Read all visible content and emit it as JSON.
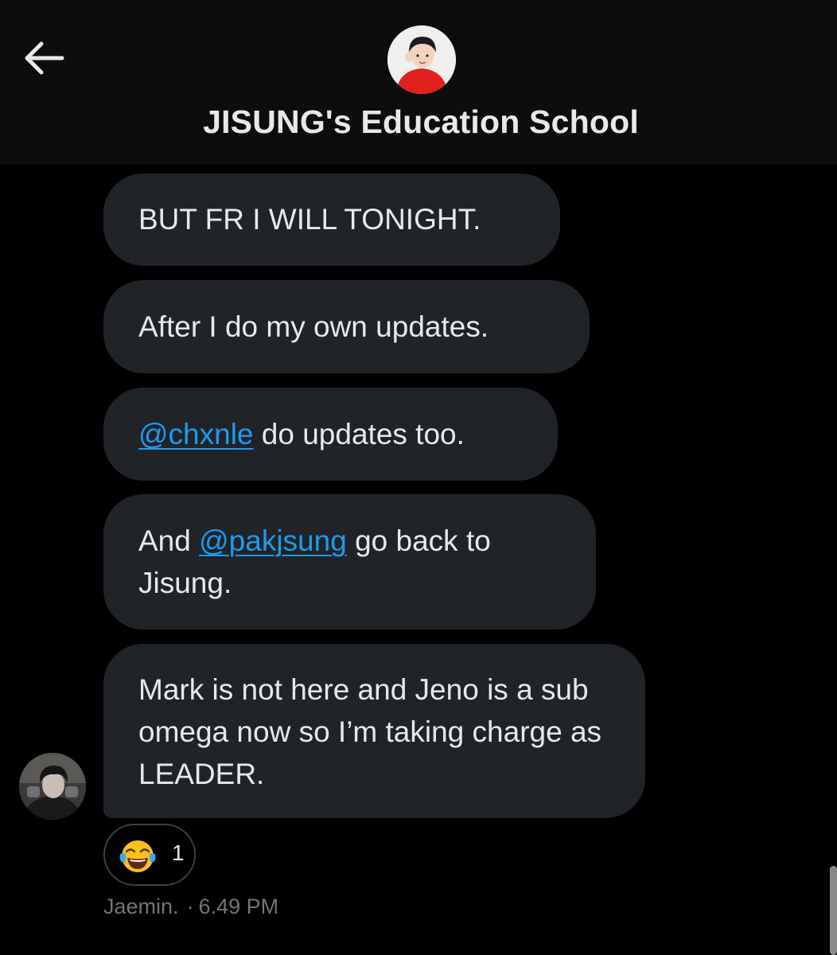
{
  "header": {
    "back_icon": "arrow-left-icon",
    "group_name": "JISUNG's Education School"
  },
  "messages": [
    {
      "text": "BUT FR I WILL TONIGHT."
    },
    {
      "text": "After I do my own updates."
    },
    {
      "mention": "@chxnle",
      "text": " do updates too."
    },
    {
      "pre": "And ",
      "mention": "@pakjsung",
      "text": " go back to Jisung."
    },
    {
      "text": "Mark is not here and Jeno is a sub omega now so I’m taking charge as LEADER."
    }
  ],
  "reaction": {
    "emoji": "face-with-tears-of-joy-icon",
    "count": "1"
  },
  "meta": {
    "sender": "Jaemin.",
    "separator": "·",
    "time": "6.49 PM"
  },
  "colors": {
    "background": "#000000",
    "header_bg": "#0d0d0d",
    "bubble_bg": "#202327",
    "text": "#e7e9ea",
    "mention": "#1d9bf0",
    "meta": "#71767b"
  }
}
